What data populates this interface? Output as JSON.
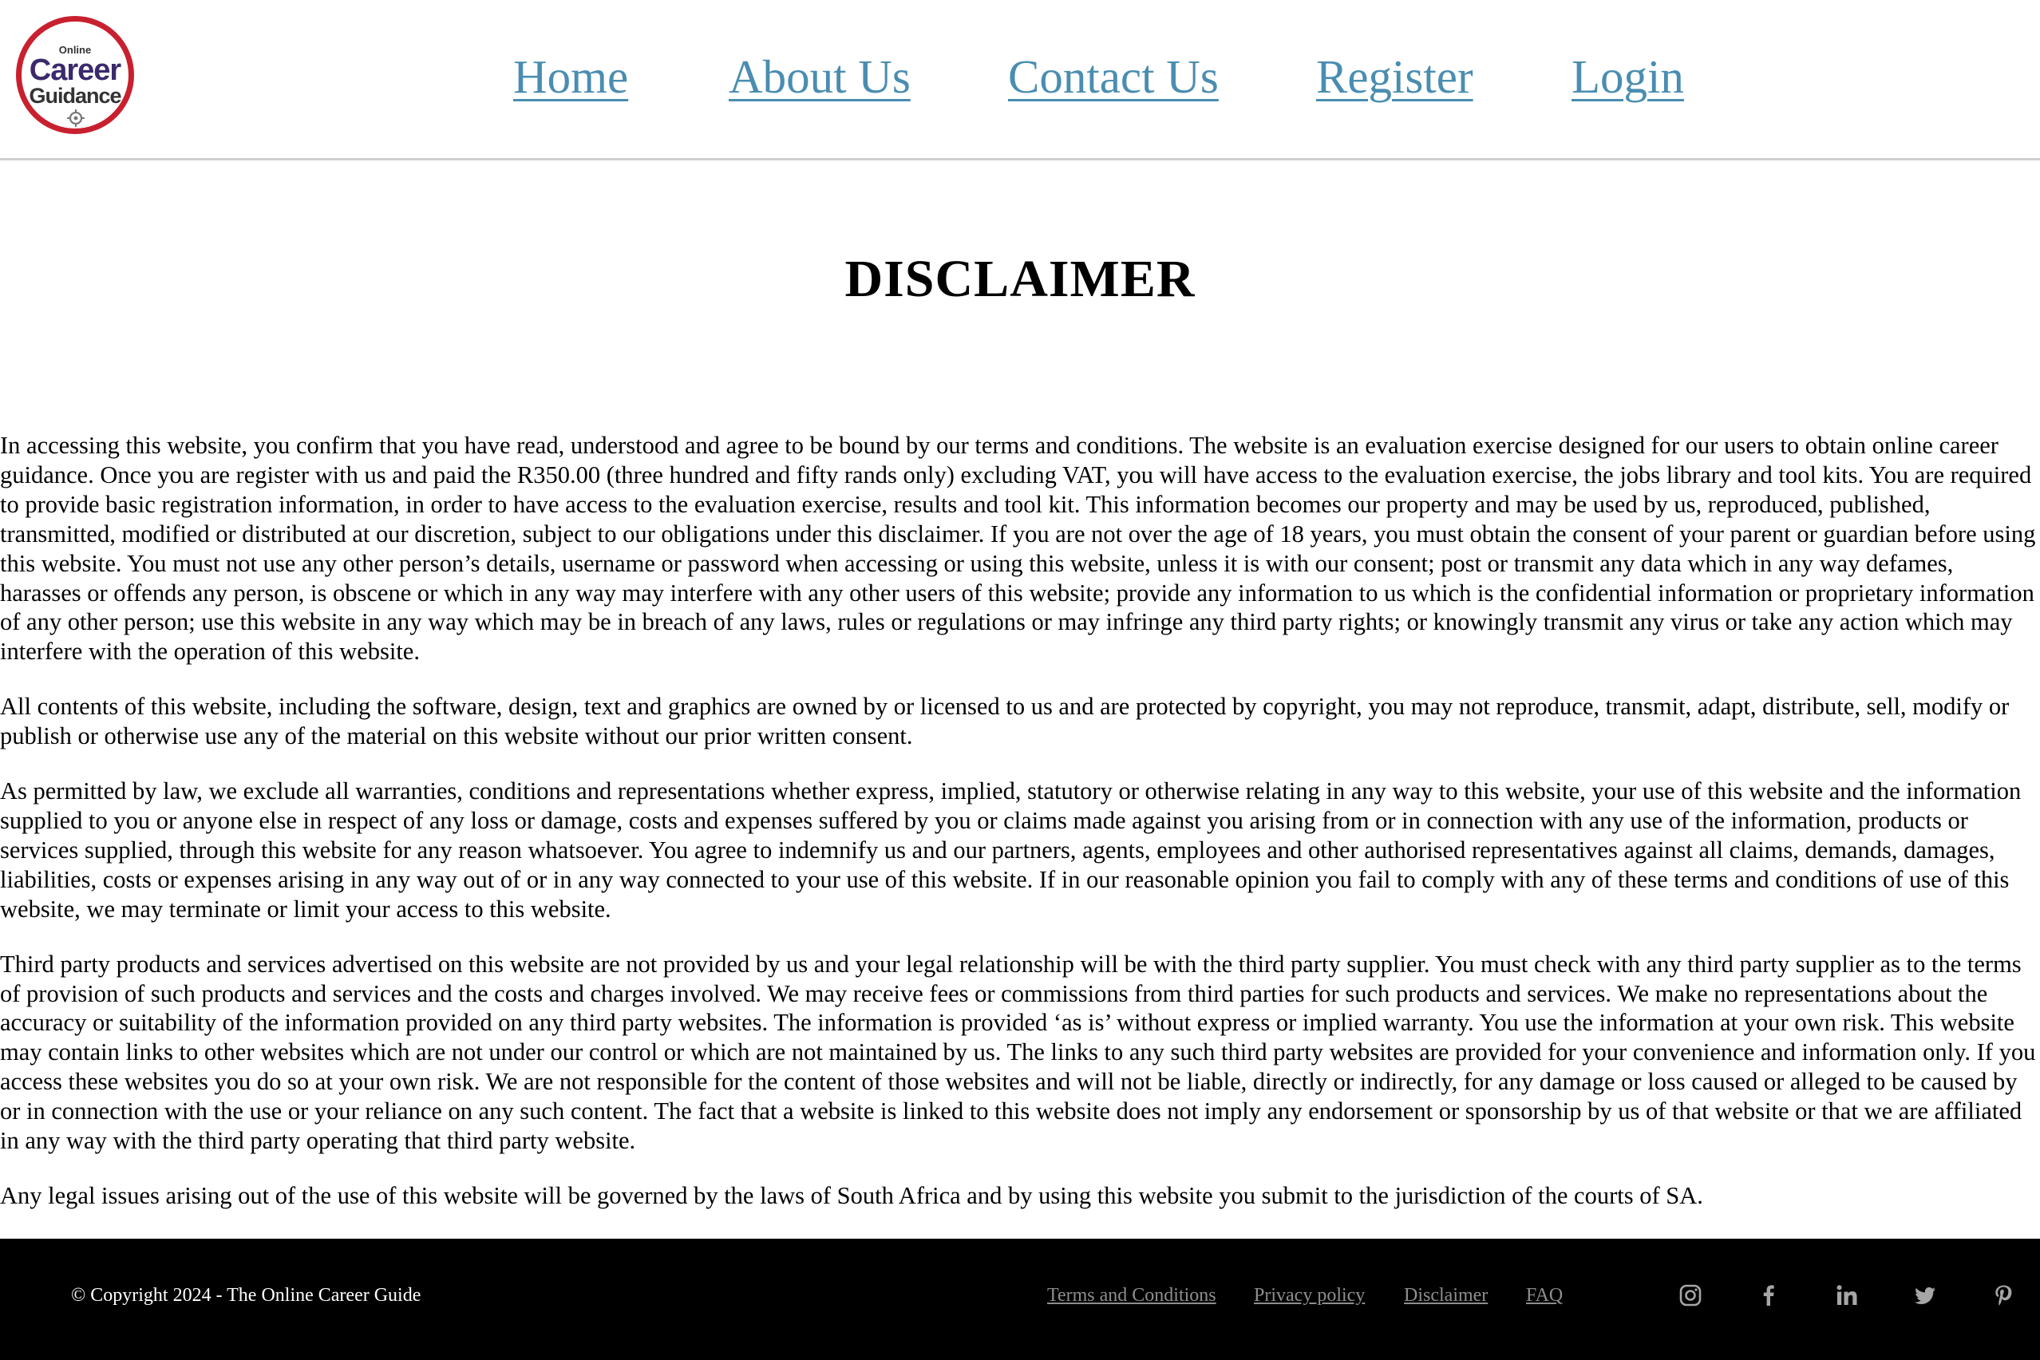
{
  "header": {
    "logo": {
      "line1": "Online",
      "line2": "Career",
      "line3": "Guidance"
    },
    "nav": [
      {
        "label": "Home"
      },
      {
        "label": "About Us"
      },
      {
        "label": "Contact Us"
      },
      {
        "label": "Register"
      },
      {
        "label": "Login"
      }
    ]
  },
  "main": {
    "title": "DISCLAIMER",
    "paragraphs": [
      "In accessing this website, you confirm that you have read, understood and agree to be bound by our terms and conditions. The website is an evaluation exercise designed for our users to obtain online career guidance. Once you are register with us and paid the R350.00 (three hundred and fifty rands only) excluding VAT, you will have access to the evaluation exercise, the jobs library and tool kits. You are required to provide basic registration information, in order to have access to the evaluation exercise, results and tool kit. This information becomes our property and may be used by us, reproduced, published, transmitted, modified or distributed at our discretion, subject to our obligations under this disclaimer. If you are not over the age of 18 years, you must obtain the consent of your parent or guardian before using this website. You must not use any other person’s details, username or password when accessing or using this website, unless it is with our consent; post or transmit any data which in any way defames, harasses or offends any person, is obscene or which in any way may interfere with any other users of this website; provide any information to us which is the confidential information or proprietary information of any other person; use this website in any way which may be in breach of any laws, rules or regulations or may infringe any third party rights; or knowingly transmit any virus or take any action which may interfere with the operation of this website.",
      "All contents of this website, including the software, design, text and graphics are owned by or licensed to us and are protected by copyright, you may not reproduce, transmit, adapt, distribute, sell, modify or publish or otherwise use any of the material on this website without our prior written consent.",
      "As permitted by law, we exclude all warranties, conditions and representations whether express, implied, statutory or otherwise relating in any way to this website, your use of this website and the information supplied to you or anyone else in respect of any loss or damage, costs and expenses suffered by you or claims made against you arising from or in connection with any use of the information, products or services supplied, through this website for any reason whatsoever. You agree to indemnify us and our partners, agents, employees and other authorised representatives against all claims, demands, damages, liabilities, costs or expenses arising in any way out of or in any way connected to your use of this website. If in our reasonable opinion you fail to comply with any of these terms and conditions of use of this website, we may terminate or limit your access to this website.",
      "Third party products and services advertised on this website are not provided by us and your legal relationship will be with the third party supplier. You must check with any third party supplier as to the terms of provision of such products and services and the costs and charges involved. We may receive fees or commissions from third parties for such products and services. We make no representations about the accuracy or suitability of the information provided on any third party websites. The information is provided ‘as is’ without express or implied warranty. You use the information at your own risk. This website may contain links to other websites which are not under our control or which are not maintained by us. The links to any such third party websites are provided for your convenience and information only. If you access these websites you do so at your own risk. We are not responsible for the content of those websites and will not be liable, directly or indirectly, for any damage or loss caused or alleged to be caused by or in connection with the use or your reliance on any such content. The fact that a website is linked to this website does not imply any endorsement or sponsorship by us of that website or that we are affiliated in any way with the third party operating that third party website.",
      "Any legal issues arising out of the use of this website will be governed by the laws of South Africa and by using this website you submit to the jurisdiction of the courts of SA."
    ]
  },
  "footer": {
    "copyright": "© Copyright 2024 - The Online Career Guide",
    "links": [
      {
        "label": "Terms and Conditions"
      },
      {
        "label": "Privacy policy"
      },
      {
        "label": "Disclaimer"
      },
      {
        "label": "FAQ"
      }
    ],
    "social": [
      "instagram-icon",
      "facebook-icon",
      "linkedin-icon",
      "twitter-icon",
      "pinterest-icon"
    ]
  },
  "colors": {
    "nav_link": "#4a8db1",
    "logo_ring": "#c8202f",
    "logo_text": "#3b2a6b",
    "footer_bg": "#000000",
    "footer_link": "#8e8e8e",
    "social_icon": "#a6a6a6"
  }
}
